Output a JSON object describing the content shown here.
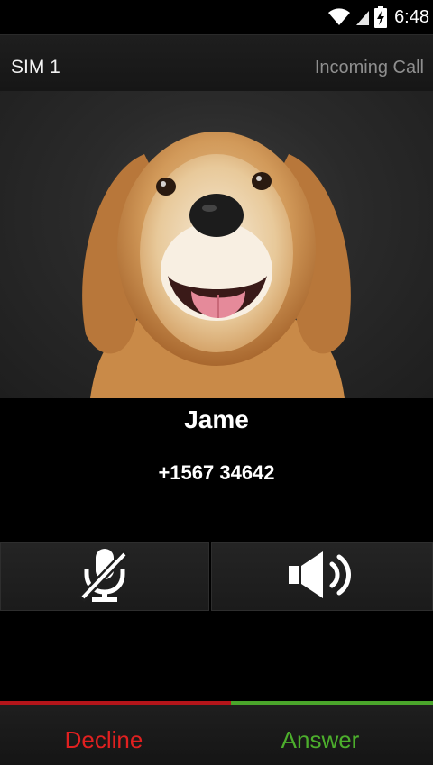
{
  "status_bar": {
    "time": "6:48",
    "icons": [
      "wifi-icon",
      "signal-icon",
      "battery-charging-icon"
    ]
  },
  "header": {
    "sim": "SIM 1",
    "call_state": "Incoming Call"
  },
  "caller": {
    "name": "Jame",
    "number": "+1567 34642",
    "photo_icon": "contact-photo-dog"
  },
  "actions": {
    "mute_icon": "mute-microphone-icon",
    "speaker_icon": "speaker-icon"
  },
  "bottom": {
    "decline_label": "Decline",
    "answer_label": "Answer",
    "decline_color": "#e02020",
    "answer_color": "#4cae2c"
  }
}
